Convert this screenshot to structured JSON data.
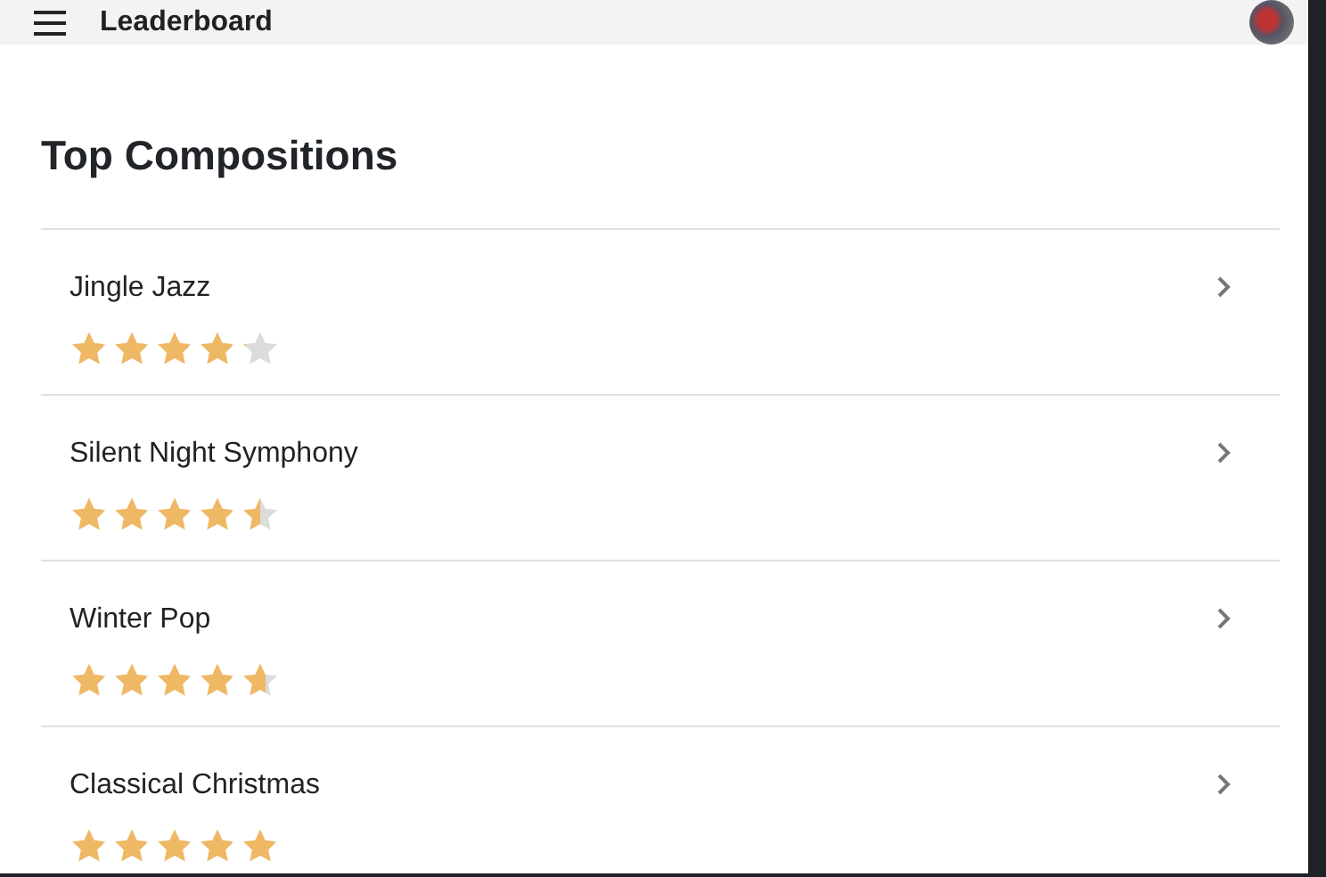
{
  "app_bar": {
    "title": "Leaderboard"
  },
  "heading": "Top Compositions",
  "compositions": [
    {
      "title": "Jingle Jazz",
      "stars": 4
    },
    {
      "title": "Silent Night Symphony",
      "stars": 4.5
    },
    {
      "title": "Winter Pop",
      "stars": 4.7
    },
    {
      "title": "Classical Christmas",
      "stars": 5
    }
  ]
}
